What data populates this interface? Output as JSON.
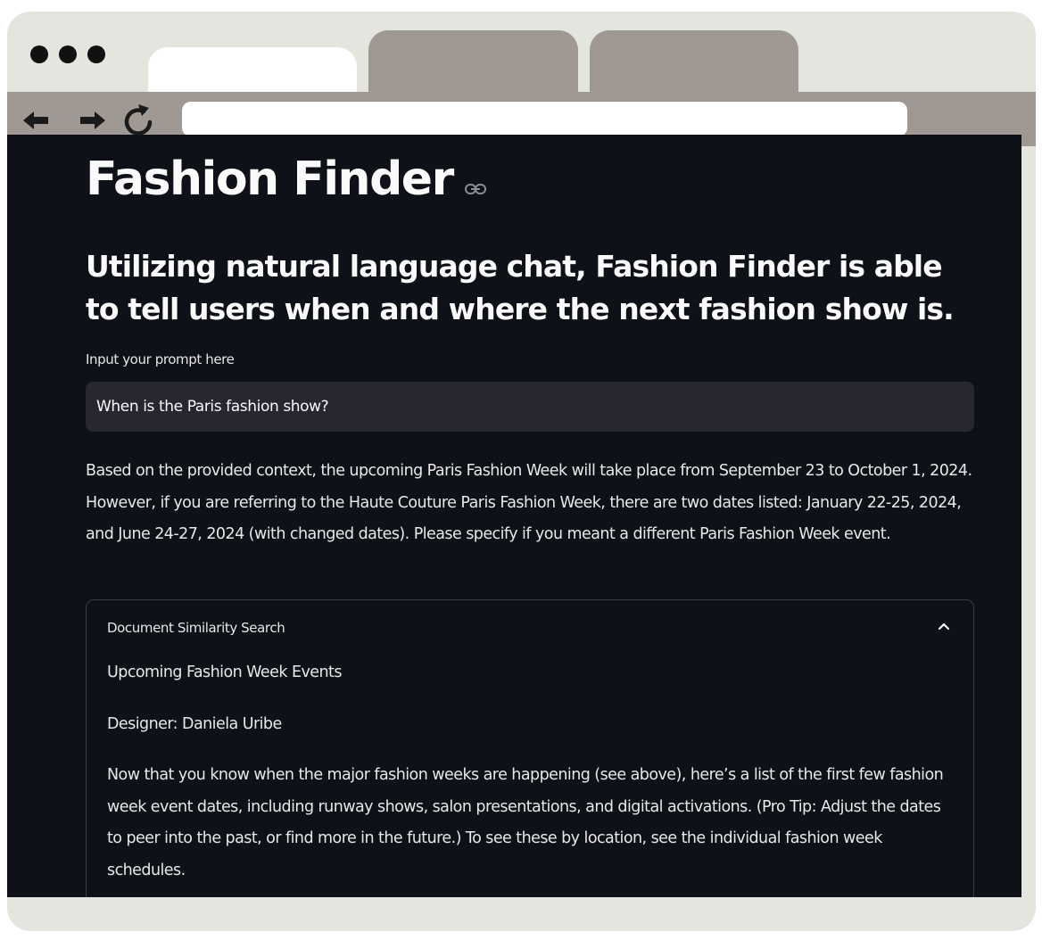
{
  "page": {
    "title": "Fashion Finder",
    "subtitle": "Utilizing natural language chat, Fashion Finder is able to tell users when and where the next fashion show is."
  },
  "prompt": {
    "label": "Input your prompt here",
    "value": "When is the Paris fashion show?"
  },
  "answer": "Based on the provided context, the upcoming Paris Fashion Week will take place from September 23 to October 1, 2024. However, if you are referring to the Haute Couture Paris Fashion Week, there are two dates listed: January 22-25, 2024, and June 24-27, 2024 (with changed dates). Please specify if you meant a different Paris Fashion Week event.",
  "expander": {
    "label": "Document Similarity Search",
    "expanded": true,
    "paragraphs": [
      "Upcoming Fashion Week Events",
      "Designer: Daniela Uribe",
      "Now that you know when the major fashion weeks are happening (see above), here’s a list of the first few fashion week event dates, including runway shows, salon presentations, and digital activations. (Pro Tip: Adjust the dates to peer into the past, or find more in the future.) To see these by location, see the individual fashion week schedules."
    ]
  },
  "icons": {
    "back": "arrow-left-icon",
    "forward": "arrow-right-icon",
    "reload": "reload-icon",
    "anchor": "link-icon",
    "chevron": "chevron-up-icon"
  },
  "colors": {
    "background": "#0e1117",
    "input_bg": "#262730",
    "browser_chrome": "#a09993",
    "frame": "#e5e5df"
  }
}
